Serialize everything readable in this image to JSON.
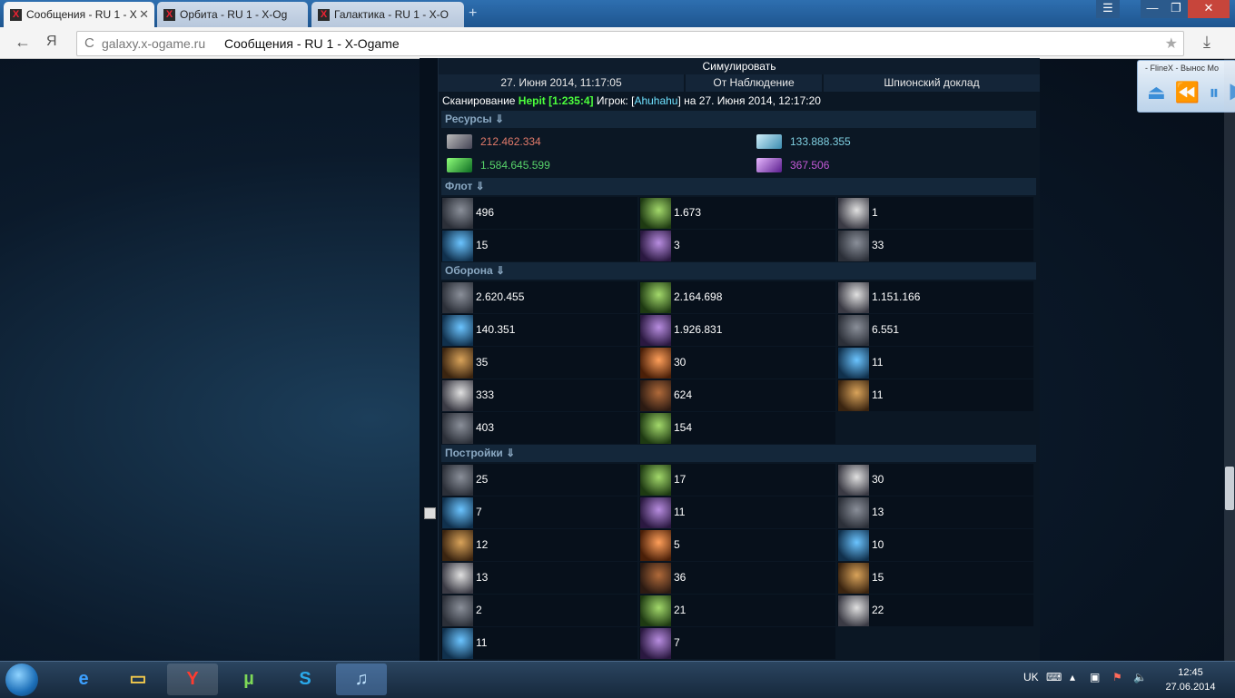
{
  "browser": {
    "tabs": [
      {
        "title": "Сообщения - RU 1 - X",
        "favicon": "x-ogame-icon",
        "active": true
      },
      {
        "title": "Орбита - RU 1 - X-Og",
        "favicon": "x-ogame-icon",
        "active": false
      },
      {
        "title": "Галактика - RU 1 - X-O",
        "favicon": "x-ogame-icon",
        "active": false
      }
    ],
    "new_tab": "+",
    "back": "←",
    "yandex": "Я",
    "reload": "C",
    "url": "galaxy.x-ogame.ru",
    "page_title": "Сообщения - RU 1 - X-Ogame",
    "star": "★",
    "download": "⤓",
    "window_buttons": [
      "☰",
      "—",
      "❐",
      "✕"
    ]
  },
  "player": {
    "title": "- FlineX - Вынос Мо",
    "controls": "⏏ ⏪ ⏸ ▶"
  },
  "report": {
    "simulate": "Симулировать",
    "date": "27. Июня 2014, 11:17:05",
    "from": "От Наблюдение",
    "subject": "Шпионский доклад",
    "scan_prefix": "Сканирование",
    "planet": "Hepit [1:235:4]",
    "player_label": "Игрок: [",
    "player": "Ahuhahu",
    "scan_suffix": "] на 27. Июня 2014, 12:17:20",
    "sections": {
      "resources": "Ресурсы ⇓",
      "fleet": "Флот ⇓",
      "defense": "Оборона ⇓",
      "buildings": "Постройки ⇓"
    },
    "resources": [
      {
        "name": "metal",
        "value": "212.462.334",
        "color": "#e07a6a"
      },
      {
        "name": "crystal",
        "value": "133.888.355",
        "color": "#7fcfe0"
      },
      {
        "name": "deuterium",
        "value": "1.584.645.599",
        "color": "#58d36a"
      },
      {
        "name": "energy",
        "value": "367.506",
        "color": "#c45ad8"
      }
    ],
    "fleet": [
      "496",
      "1.673",
      "1",
      "15",
      "3",
      "33"
    ],
    "defense": [
      "2.620.455",
      "2.164.698",
      "1.151.166",
      "140.351",
      "1.926.831",
      "6.551",
      "35",
      "30",
      "11",
      "333",
      "624",
      "11",
      "403",
      "154"
    ],
    "buildings": [
      "25",
      "17",
      "30",
      "7",
      "11",
      "13",
      "12",
      "5",
      "10",
      "13",
      "36",
      "15",
      "2",
      "21",
      "22",
      "11",
      "7"
    ]
  },
  "taskbar": {
    "apps": [
      "internet-explorer-icon",
      "file-explorer-icon",
      "yandex-browser-icon",
      "utorrent-icon",
      "skype-icon",
      "music-player-icon"
    ],
    "lang": "UK",
    "time": "12:45",
    "date": "27.06.2014"
  }
}
